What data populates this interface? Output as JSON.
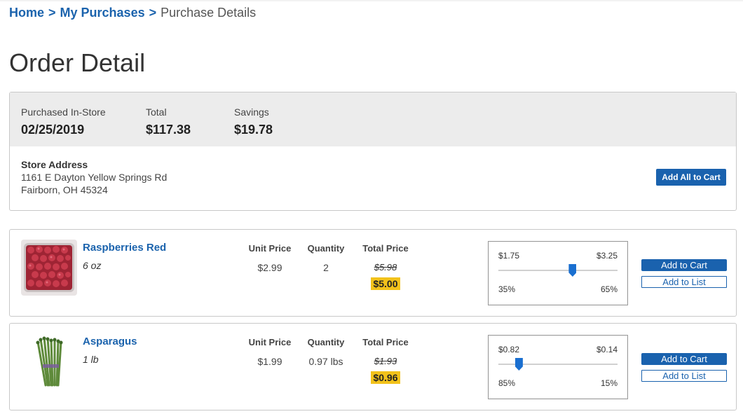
{
  "breadcrumb": {
    "home": "Home",
    "sep1": ">",
    "purchases": "My Purchases",
    "sep2": ">",
    "current": "Purchase Details"
  },
  "page_title": "Order Detail",
  "summary": {
    "purchased_label": "Purchased In-Store",
    "purchased_date": "02/25/2019",
    "total_label": "Total",
    "total_value": "$117.38",
    "savings_label": "Savings",
    "savings_value": "$19.78",
    "address_title": "Store Address",
    "address_line1": "1161 E Dayton Yellow Springs Rd",
    "address_line2": "Fairborn, OH 45324",
    "add_all_label": "Add All to Cart"
  },
  "columns": {
    "unit_price": "Unit Price",
    "quantity": "Quantity",
    "total_price": "Total Price"
  },
  "buttons": {
    "add_to_cart": "Add to Cart",
    "add_to_list": "Add to List"
  },
  "items": [
    {
      "name": "Raspberries Red",
      "size": "6 oz",
      "unit_price": "$2.99",
      "quantity": "2",
      "original_total": "$5.98",
      "sale_total": "$5.00",
      "range": {
        "left_price": "$1.75",
        "right_price": "$3.25",
        "left_pct": "35%",
        "right_pct": "65%",
        "handle_fraction": 0.62
      },
      "image_icon": "raspberries-image"
    },
    {
      "name": "Asparagus",
      "size": "1 lb",
      "unit_price": "$1.99",
      "quantity": "0.97 lbs",
      "original_total": "$1.93",
      "sale_total": "$0.96",
      "range": {
        "left_price": "$0.82",
        "right_price": "$0.14",
        "left_pct": "85%",
        "right_pct": "15%",
        "handle_fraction": 0.17
      },
      "image_icon": "asparagus-image"
    }
  ],
  "colors": {
    "link_blue": "#1b63ad",
    "button_blue": "#1a62ae",
    "sale_highlight": "#f2c21b",
    "summary_bg": "#ececec",
    "slider_handle": "#1a6fd0"
  }
}
